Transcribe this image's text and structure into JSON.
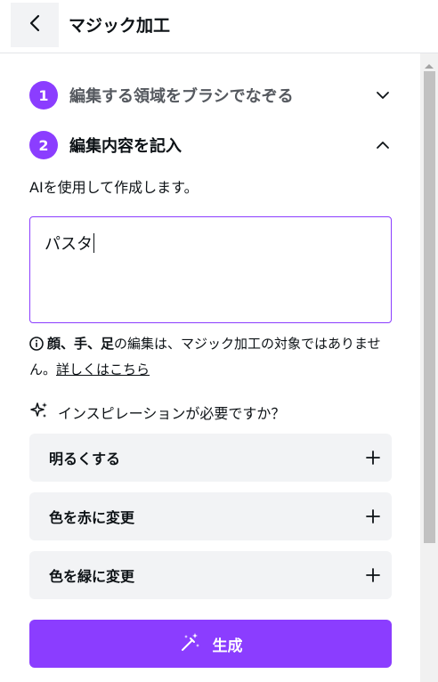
{
  "header": {
    "title": "マジック加工",
    "back_icon": "chevron-left-icon"
  },
  "steps": [
    {
      "number": "1",
      "label": "編集する領域をブラシでなぞる",
      "state": "collapsed"
    },
    {
      "number": "2",
      "label": "編集内容を記入",
      "state": "expanded"
    }
  ],
  "description": "AIを使用して作成します。",
  "prompt_input": {
    "value": "パスタ"
  },
  "notice": {
    "bold_text": "顔、手、足",
    "text": "の編集は、マジック加工の対象ではありません。",
    "link": "詳しくはこちら"
  },
  "inspiration": {
    "label": "インスピレーションが必要ですか？",
    "icon": "sparkle-icon"
  },
  "suggestions": [
    {
      "label": "明るくする"
    },
    {
      "label": "色を赤に変更"
    },
    {
      "label": "色を緑に変更"
    }
  ],
  "generate_button": {
    "label": "生成",
    "icon": "magic-wand-icon"
  },
  "colors": {
    "accent": "#8b3dff",
    "card_bg": "#f2f3f5",
    "text": "#0d1216"
  }
}
